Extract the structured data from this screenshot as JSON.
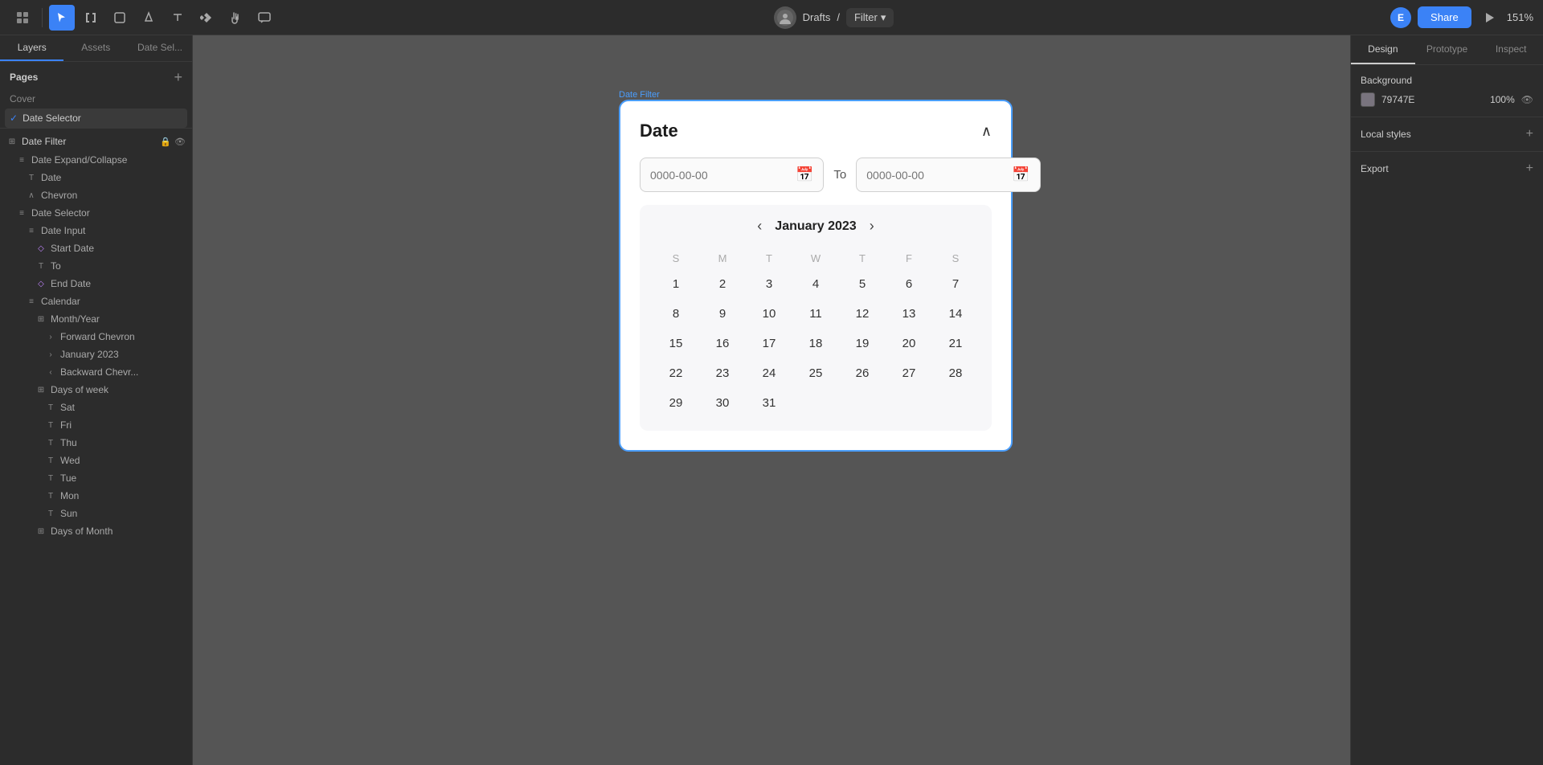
{
  "toolbar": {
    "user_initial": "E",
    "drafts_label": "Drafts",
    "separator": "/",
    "filter_label": "Filter",
    "share_label": "Share",
    "zoom_level": "151%"
  },
  "left_panel": {
    "tabs": [
      "Layers",
      "Assets"
    ],
    "active_tab": "Layers",
    "date_sel_tab": "Date Sel...",
    "pages_title": "Pages",
    "pages_add": "+",
    "pages": [
      {
        "label": "Cover",
        "active": false
      },
      {
        "label": "Date Selector",
        "active": true
      }
    ],
    "layers": [
      {
        "label": "Date Filter",
        "icon": "frame",
        "indent": 0,
        "has_lock": true,
        "has_eye": true
      },
      {
        "label": "Date Expand/Collapse",
        "icon": "equal",
        "indent": 1
      },
      {
        "label": "Date",
        "icon": "text",
        "indent": 2
      },
      {
        "label": "Chevron",
        "icon": "chevron-up",
        "indent": 2
      },
      {
        "label": "Date Selector",
        "icon": "equal",
        "indent": 1
      },
      {
        "label": "Date Input",
        "icon": "equal",
        "indent": 2
      },
      {
        "label": "Start Date",
        "icon": "diamond",
        "indent": 3
      },
      {
        "label": "To",
        "icon": "text",
        "indent": 3
      },
      {
        "label": "End Date",
        "icon": "diamond",
        "indent": 3
      },
      {
        "label": "Calendar",
        "icon": "equal",
        "indent": 2
      },
      {
        "label": "Month/Year",
        "icon": "grid",
        "indent": 3
      },
      {
        "label": "Forward Chevron",
        "icon": "chevron-right",
        "indent": 4
      },
      {
        "label": "January 2023",
        "icon": "chevron-right",
        "indent": 4
      },
      {
        "label": "Backward Chevr...",
        "icon": "chevron-left",
        "indent": 4
      },
      {
        "label": "Days of week",
        "icon": "grid",
        "indent": 3
      },
      {
        "label": "Sat",
        "icon": "text",
        "indent": 4
      },
      {
        "label": "Fri",
        "icon": "text",
        "indent": 4
      },
      {
        "label": "Thu",
        "icon": "text",
        "indent": 4
      },
      {
        "label": "Wed",
        "icon": "text",
        "indent": 4
      },
      {
        "label": "Tue",
        "icon": "text",
        "indent": 4
      },
      {
        "label": "Mon",
        "icon": "text",
        "indent": 4
      },
      {
        "label": "Sun",
        "icon": "text",
        "indent": 4
      },
      {
        "label": "Days of Month",
        "icon": "grid",
        "indent": 3
      }
    ]
  },
  "canvas": {
    "label": "Date Filter",
    "background_color": "#555555",
    "component": {
      "title": "Date",
      "start_date_placeholder": "0000-00-00",
      "end_date_placeholder": "0000-00-00",
      "to_label": "To",
      "month_year": "January 2023",
      "days_of_week": [
        "S",
        "M",
        "T",
        "W",
        "T",
        "F",
        "S"
      ],
      "weeks": [
        [
          "",
          "",
          "",
          "",
          "",
          "",
          ""
        ],
        [
          "1",
          "2",
          "3",
          "4",
          "5",
          "6",
          "7"
        ],
        [
          "8",
          "9",
          "10",
          "11",
          "12",
          "13",
          "14"
        ],
        [
          "15",
          "16",
          "17",
          "18",
          "19",
          "20",
          "21"
        ],
        [
          "22",
          "23",
          "24",
          "25",
          "26",
          "27",
          "28"
        ],
        [
          "29",
          "30",
          "31",
          "",
          "",
          "",
          ""
        ]
      ]
    }
  },
  "right_panel": {
    "tabs": [
      "Design",
      "Prototype",
      "Inspect"
    ],
    "active_tab": "Design",
    "background": {
      "title": "Background",
      "swatch_color": "#79747E",
      "color_label": "79747E",
      "opacity": "100%",
      "eye_visible": true
    },
    "local_styles": {
      "title": "Local styles",
      "add_label": "+"
    },
    "export": {
      "title": "Export",
      "add_label": "+"
    }
  }
}
